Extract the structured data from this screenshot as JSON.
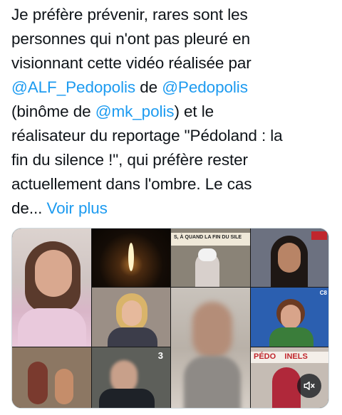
{
  "tweet": {
    "lines": [
      "Je préfère prévenir, rares sont les",
      "personnes qui n'ont pas pleuré en",
      "visionnant cette vidéo réalisée par"
    ],
    "mention1": "@ALF_Pedopolis",
    "word_de": " de ",
    "mention2": "@Pedopolis",
    "paren_open": "(binôme de ",
    "mention3": "@mk_polis",
    "paren_rest": ") et le",
    "lines_after": [
      "réalisateur du reportage \"Pédoland : la",
      "fin du silence !\", qui préfère rester",
      "actuellement dans l'ombre. Le cas"
    ],
    "truncated": "de... ",
    "show_more": "Voir plus"
  },
  "video": {
    "captions": {
      "banner": "S, À QUAND LA FIN DU SILE",
      "logo_c8": "C8",
      "num3": "3",
      "pedo_banner": "PÉDO    INELS"
    },
    "icons": {
      "mute": "speaker-muted-icon"
    },
    "colors": {
      "accent": "#1d9bf0",
      "text": "#0f1419"
    }
  }
}
